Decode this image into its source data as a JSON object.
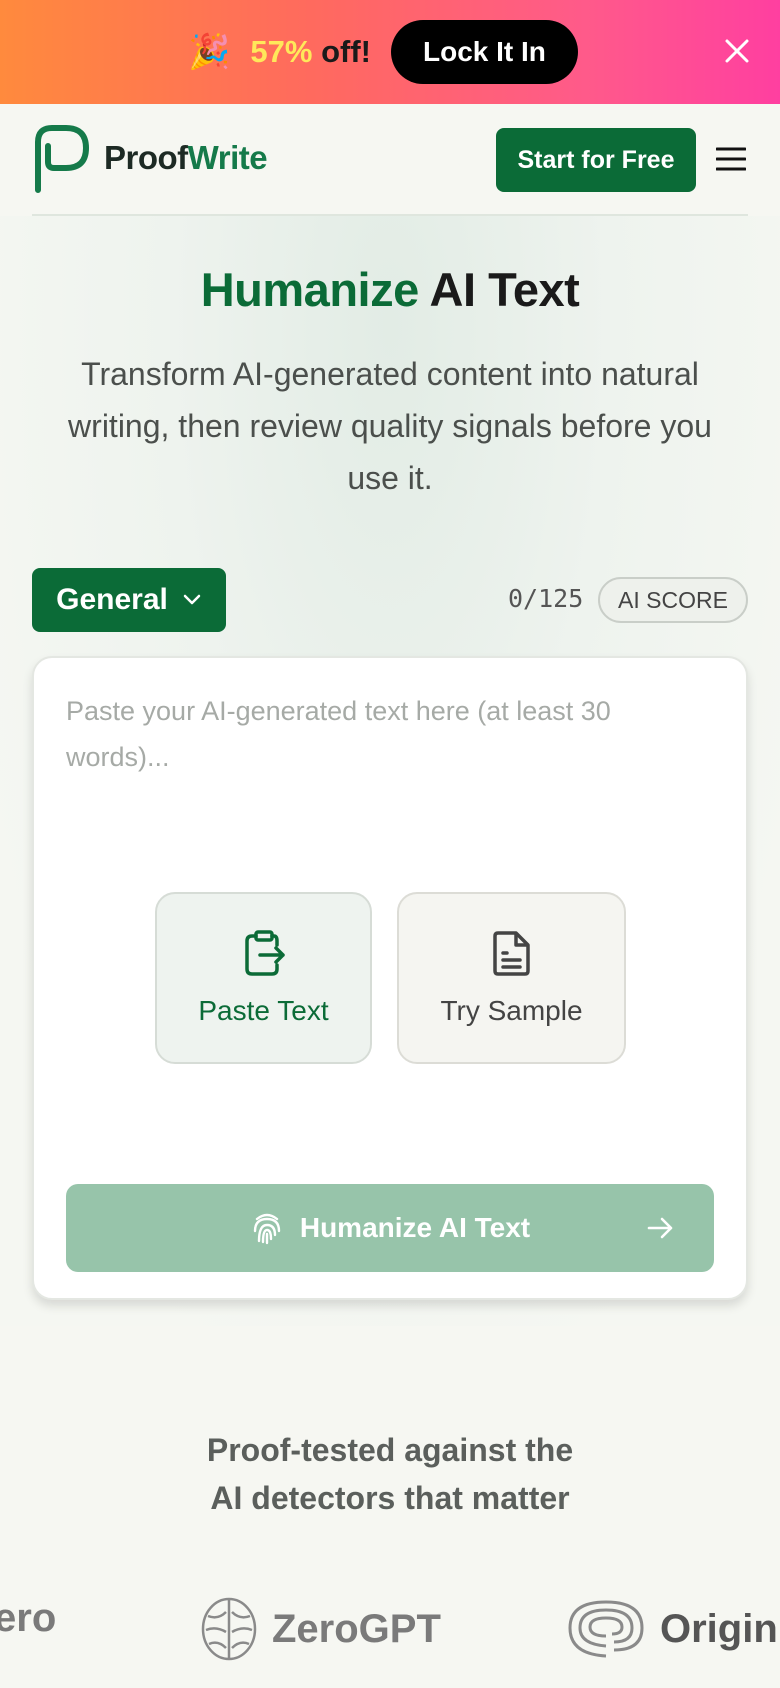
{
  "promo": {
    "emoji": "🎉",
    "discount": "57%",
    "off_text": " off!",
    "cta_label": "Lock It In"
  },
  "header": {
    "logo_proof": "Proof",
    "logo_write": "Write",
    "start_label": "Start for Free"
  },
  "hero": {
    "title_green": "Humanize",
    "title_rest": " AI Text",
    "subtitle": "Transform AI-generated content into natural writing, then review quality signals before you use it."
  },
  "controls": {
    "mode_label": "General",
    "word_count": "0/125",
    "ai_score_label": "AI SCORE"
  },
  "editor": {
    "placeholder": "Paste your AI-generated text here (at least 30 words)...",
    "paste_label": "Paste Text",
    "sample_label": "Try Sample",
    "humanize_label": "Humanize AI Text"
  },
  "detectors": {
    "title_line1": "Proof-tested against the",
    "title_line2": "AI detectors that matter",
    "items": [
      "ero",
      "ZeroGPT",
      "Origin"
    ]
  },
  "colors": {
    "brand_green": "#0b6b37",
    "disabled_green": "#97c4aa",
    "promo_yellow": "#ffe85a"
  }
}
